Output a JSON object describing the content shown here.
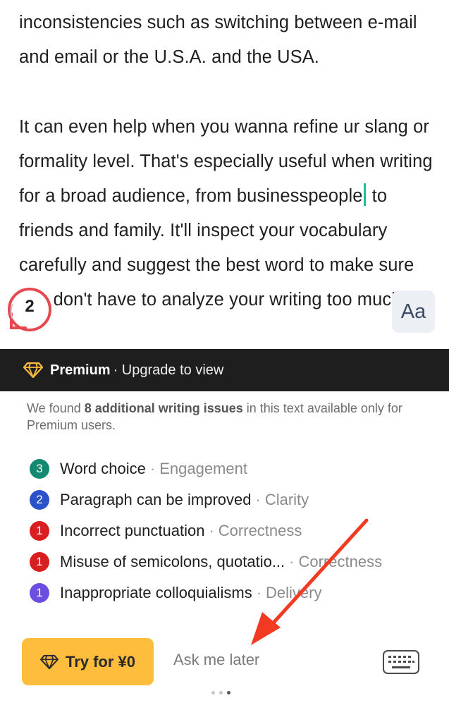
{
  "editor": {
    "para1": "inconsistencies such as switching between e-mail and email or the U.S.A. and the USA.",
    "para2_before_caret": "It can even help when you wanna refine ur slang or formality level. That's especially useful when writing for a broad audience, from businesspeople",
    "para2_after_caret": " to friends and family. It'll inspect your vocabulary carefully and suggest the best word to make sure you don't have to analyze your writing too much."
  },
  "badge": {
    "count": "2",
    "color": "#e5484d"
  },
  "aa_button": {
    "label": "Aa"
  },
  "premium_bar": {
    "title": "Premium",
    "subtitle": "· Upgrade to view",
    "icon": "diamond-icon",
    "accent": "#ffbd3d"
  },
  "notice": {
    "prefix": "We found ",
    "highlight": "8 additional writing issues",
    "suffix": " in this text available only for Premium users."
  },
  "issues": [
    {
      "count": "3",
      "name": "Word choice",
      "sep": "·",
      "category": "Engagement",
      "color": "#128a70"
    },
    {
      "count": "2",
      "name": "Paragraph can be improved",
      "sep": "·",
      "category": "Clarity",
      "color": "#2a52c8"
    },
    {
      "count": "1",
      "name": "Incorrect punctuation",
      "sep": "·",
      "category": "Correctness",
      "color": "#d81e1e"
    },
    {
      "count": "1",
      "name": "Misuse of semicolons, quotatio...",
      "sep": "·",
      "category": "Correctness",
      "color": "#d81e1e"
    },
    {
      "count": "1",
      "name": "Inappropriate colloquialisms",
      "sep": "·",
      "category": "Delivery",
      "color": "#6d4fe0"
    }
  ],
  "actions": {
    "try_label": "Try for ¥0",
    "later_label": "Ask me later",
    "keyboard_icon": "keyboard-icon"
  },
  "pager": {
    "active_index": 2,
    "count": 3
  },
  "annotation": {
    "color": "#f23a22"
  }
}
